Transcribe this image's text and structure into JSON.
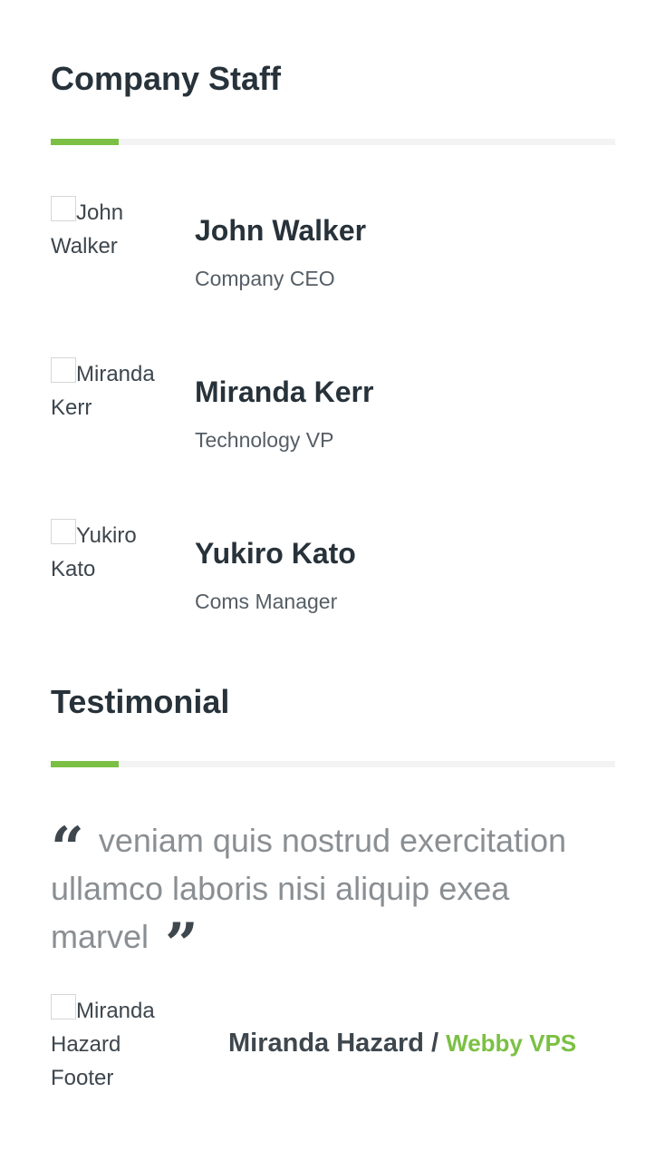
{
  "staff_section": {
    "title": "Company Staff",
    "members": [
      {
        "alt_line1": "John",
        "alt_line2": "Walker",
        "name": "John Walker",
        "role": "Company CEO"
      },
      {
        "alt_line1": "Miranda",
        "alt_line2": "Kerr",
        "name": "Miranda Kerr",
        "role": "Technology VP"
      },
      {
        "alt_line1": "Yukiro",
        "alt_line2": "Kato",
        "name": "Yukiro Kato",
        "role": "Coms Manager"
      }
    ]
  },
  "testimonial_section": {
    "title": "Testimonial",
    "quote": "veniam quis nostrud exercitation ullamco laboris nisi aliquip exea marvel",
    "open_quote_glyph": "“",
    "close_quote_glyph": "”",
    "author": {
      "alt_line1": "Miranda",
      "alt_line2": "Hazard",
      "alt_line3": "Footer",
      "name": "Miranda Hazard",
      "separator": "/",
      "company": "Webby VPS"
    }
  },
  "colors": {
    "accent": "#7bc044",
    "heading": "#27323a",
    "quote_text": "#8a8f93"
  }
}
